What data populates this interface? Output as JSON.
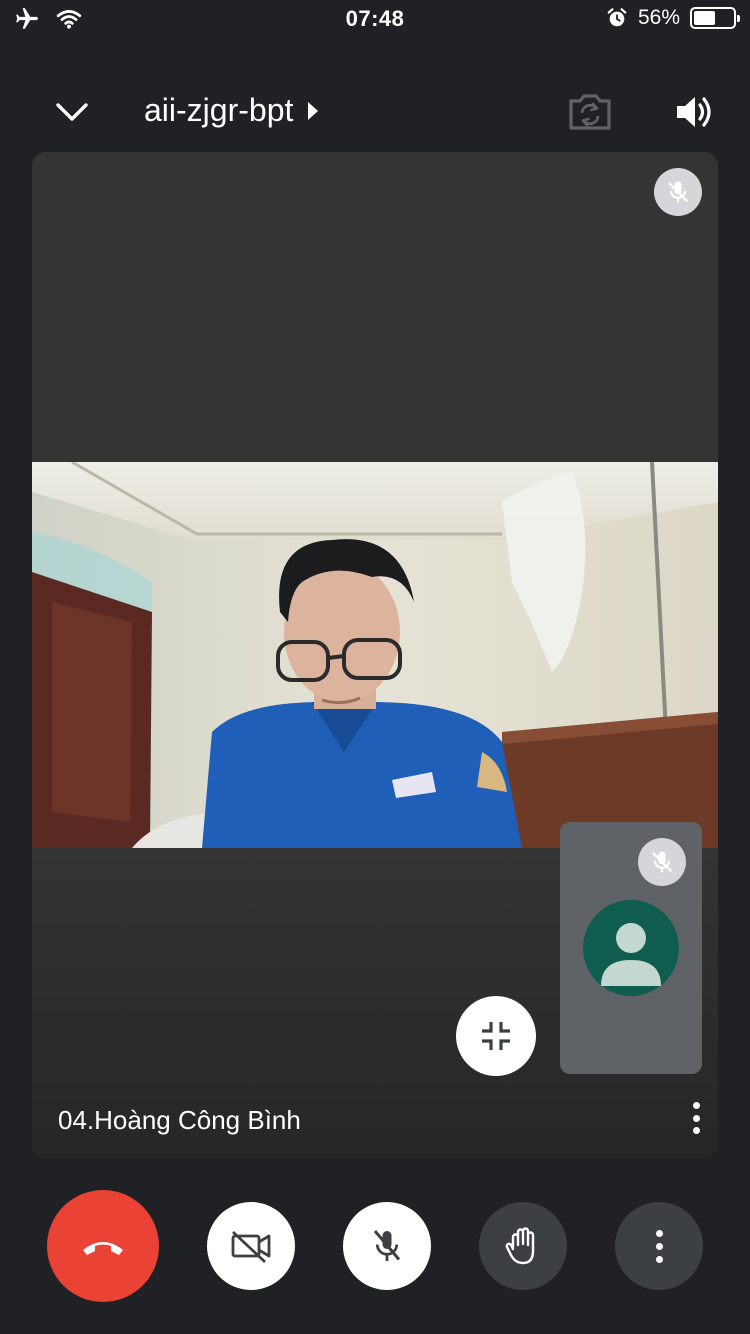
{
  "status_bar": {
    "time": "07:48",
    "battery_percent": "56%",
    "battery_level": 0.56,
    "icons": [
      "airplane-icon",
      "wifi-icon",
      "alarm-icon",
      "battery-icon"
    ]
  },
  "header": {
    "meeting_code": "aii-zjgr-bpt",
    "icons": [
      "chevron-down-icon",
      "play-arrow-icon",
      "switch-camera-icon",
      "speaker-icon"
    ]
  },
  "main_tile": {
    "participant_name": "04.Hoàng Công Bình",
    "muted": true
  },
  "self_view": {
    "muted": true,
    "avatar_icon": "person-icon",
    "avatar_color": "#0f5d4e"
  },
  "controls": {
    "buttons": [
      "end-call",
      "camera-off",
      "microphone-off",
      "raise-hand",
      "more-options"
    ],
    "end_call_color": "#ea4335"
  }
}
